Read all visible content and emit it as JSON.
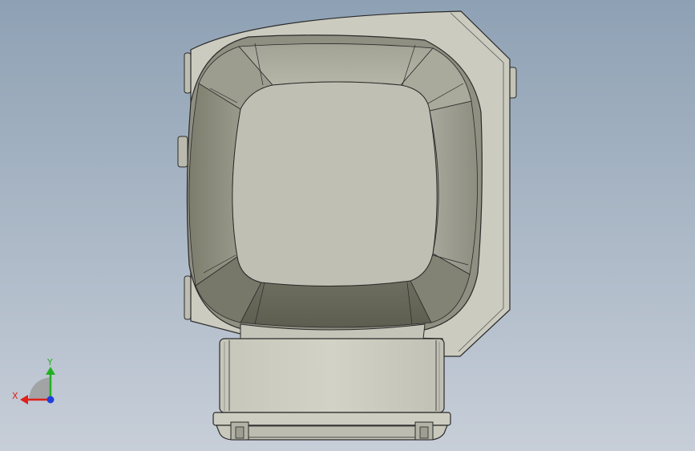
{
  "viewport": {
    "background_top": "#8ea1b4",
    "background_bottom": "#c7ced8"
  },
  "model": {
    "body_color": "#cbcbbf",
    "cavity_color": "#bfbfb3",
    "edge_color": "#2a2a2a"
  },
  "triad": {
    "x_label": "X",
    "y_label": "Y",
    "x_color": "#e0201a",
    "y_color": "#22b022",
    "z_color": "#1f3fd8"
  }
}
